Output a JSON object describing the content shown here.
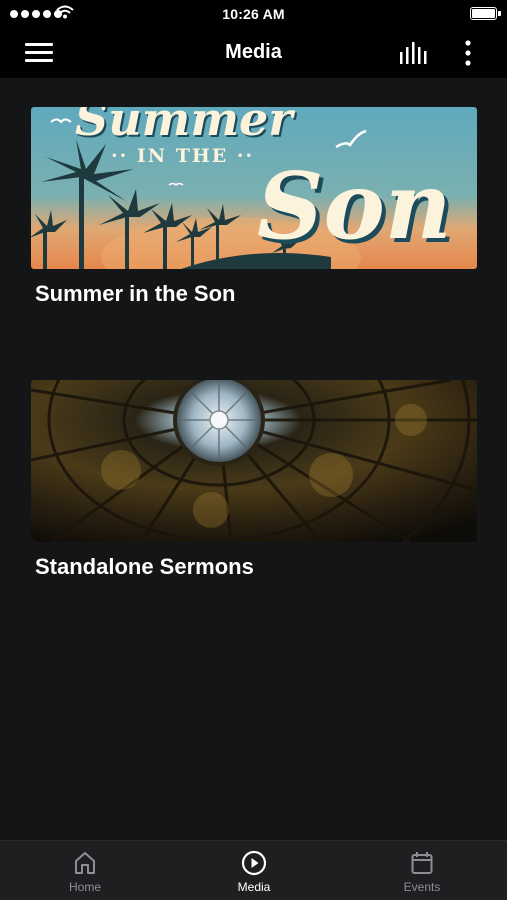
{
  "status_bar": {
    "time": "10:26 AM",
    "signal_icon": "signal-dots-icon",
    "wifi_icon": "wifi-icon",
    "battery_icon": "battery-icon"
  },
  "nav": {
    "title": "Media",
    "menu_icon": "hamburger-menu-icon",
    "audio_icon": "audio-bars-icon",
    "more_icon": "vertical-ellipsis-icon"
  },
  "media": {
    "items": [
      {
        "title": "Summer in the Son",
        "artwork_text": {
          "top": "Summer",
          "middle": "·· IN THE ··",
          "bottom": "Son"
        }
      },
      {
        "title": "Standalone Sermons"
      }
    ]
  },
  "tabs": [
    {
      "label": "Home",
      "icon": "home-icon",
      "active": false
    },
    {
      "label": "Media",
      "icon": "play-circle-icon",
      "active": true
    },
    {
      "label": "Events",
      "icon": "calendar-icon",
      "active": false
    }
  ],
  "colors": {
    "background": "#141516",
    "bars": "#000000",
    "tab_bar": "#1e1f21",
    "inactive_tab": "#8e8f93",
    "active_tab": "#ffffff"
  }
}
